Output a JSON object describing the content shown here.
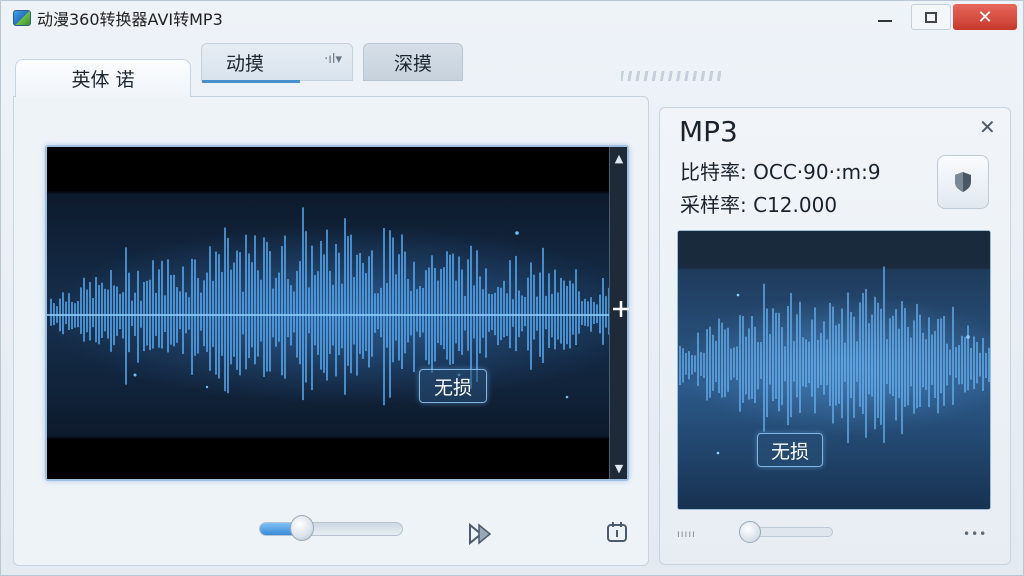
{
  "window": {
    "title": "动漫360转换器AVI转MP3",
    "minimize_icon": "minimize-icon",
    "maximize_icon": "maximize-icon",
    "close_icon": "close-icon",
    "close_glyph": "✕"
  },
  "tabs": [
    {
      "label": "英体 诺",
      "active": true
    },
    {
      "label": "动摸",
      "active": false,
      "extra_icon": "audio-split-icon",
      "extra_glyph": "·ıl▾"
    },
    {
      "label": "深摸",
      "active": false
    }
  ],
  "main": {
    "badge": "无损",
    "scroll_up_glyph": "▲",
    "scroll_down_glyph": "▼",
    "volume_percent": 30,
    "play_icon": "play-skip-icon",
    "settings_icon": "gear-file-icon",
    "crosshair_icon": "crosshair-icon"
  },
  "side": {
    "format": "MP3",
    "close_glyph": "✕",
    "bitrate_label": "比特率:",
    "bitrate_value": "OCC·90·:m:9",
    "samplerate_label": "采样率:",
    "samplerate_value": "C12.000",
    "badge": "无损",
    "action_icon": "shield-icon",
    "mini_slider_percent": 10,
    "dots_left": "ııııı",
    "dots_right": "•••"
  },
  "colors": {
    "accent": "#4a8fcf",
    "wave": "#4fa3f0",
    "close_red": "#d04a3e"
  }
}
